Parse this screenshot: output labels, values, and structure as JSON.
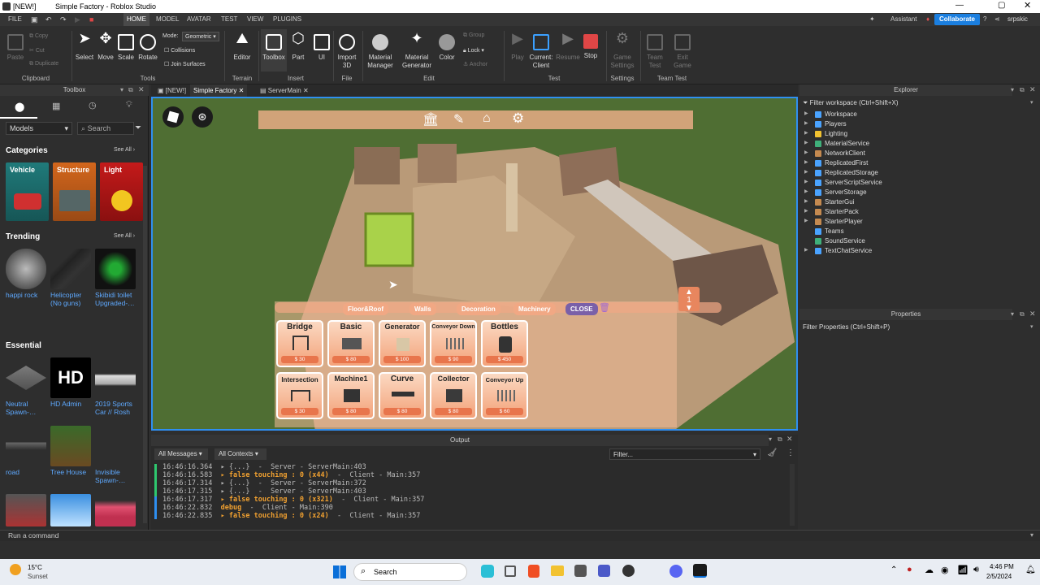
{
  "window": {
    "title_left": "[NEW!]",
    "title": "Simple Factory - Roblox Studio"
  },
  "menu": [
    "FILE",
    "HOME",
    "MODEL",
    "AVATAR",
    "TEST",
    "VIEW",
    "PLUGINS"
  ],
  "header_right": {
    "assistant": "Assistant",
    "collaborate": "Collaborate",
    "user": "srpskic"
  },
  "ribbon": {
    "clipboard": {
      "paste": "Paste",
      "copy": "Copy",
      "cut": "Cut",
      "duplicate": "Duplicate",
      "group": "Clipboard"
    },
    "tools": {
      "select": "Select",
      "move": "Move",
      "scale": "Scale",
      "rotate": "Rotate",
      "mode_label": "Mode:",
      "mode_value": "Geometric",
      "collisions": "Collisions",
      "join": "Join Surfaces",
      "group": "Tools"
    },
    "terrain": {
      "editor": "Editor",
      "group": "Terrain"
    },
    "insert": {
      "toolbox": "Toolbox",
      "part": "Part",
      "ui": "UI",
      "group": "Insert"
    },
    "file": {
      "import": "Import\n3D",
      "group": "File"
    },
    "edit": {
      "material": "Material\nManager",
      "matgen": "Material\nGenerator",
      "color": "Color",
      "group_btn": "Group",
      "lock": "Lock",
      "anchor": "Anchor",
      "group": "Edit"
    },
    "test": {
      "play": "Play",
      "current": "Current:\nClient",
      "resume": "Resume",
      "stop": "Stop",
      "group": "Test"
    },
    "settings": {
      "game": "Game\nSettings",
      "group": "Settings"
    },
    "team": {
      "teamtest": "Team\nTest",
      "exit": "Exit\nGame",
      "group": "Team Test"
    }
  },
  "toolbox": {
    "title": "Toolbox",
    "dropdown": "Models",
    "search": "Search",
    "categories_h": "Categories",
    "see_all": "See All",
    "categories": [
      "Vehicle",
      "Structure",
      "Light"
    ],
    "trending_h": "Trending",
    "trending": [
      "happi rock",
      "Helicopter\n(No guns)",
      "Skibidi toilet\nUpgraded-…"
    ],
    "essential_h": "Essential",
    "essential": [
      "Neutral\nSpawn-…",
      "HD Admin",
      "2019 Sports\nCar // Rosh",
      "road",
      "Tree House",
      "Invisible\nSpawn-…"
    ]
  },
  "doc_tabs": [
    "[NEW!]",
    "Simple Factory",
    "ServerMain"
  ],
  "game_ui": {
    "categories": [
      "Floor&Roof",
      "Walls",
      "Decoration",
      "Machinery"
    ],
    "close": "CLOSE",
    "counter": "1",
    "items": [
      {
        "name": "Bridge",
        "price": "$ 30"
      },
      {
        "name": "Basic",
        "price": "$ 80"
      },
      {
        "name": "Generator",
        "price": "$ 100"
      },
      {
        "name": "Conveyor Down",
        "price": "$ 90"
      },
      {
        "name": "Bottles",
        "price": "$ 450"
      },
      {
        "name": "Intersection",
        "price": "$ 30"
      },
      {
        "name": "Machine1",
        "price": "$ 80"
      },
      {
        "name": "Curve",
        "price": "$ 80"
      },
      {
        "name": "Collector",
        "price": "$ 80"
      },
      {
        "name": "Conveyor Up",
        "price": "$ 60"
      }
    ]
  },
  "explorer": {
    "title": "Explorer",
    "filter": "Filter workspace (Ctrl+Shift+X)",
    "items": [
      "Workspace",
      "Players",
      "Lighting",
      "MaterialService",
      "NetworkClient",
      "ReplicatedFirst",
      "ReplicatedStorage",
      "ServerScriptService",
      "ServerStorage",
      "StarterGui",
      "StarterPack",
      "StarterPlayer",
      "Teams",
      "SoundService",
      "TextChatService"
    ]
  },
  "properties": {
    "title": "Properties",
    "filter": "Filter Properties (Ctrl+Shift+P)"
  },
  "output": {
    "title": "Output",
    "all_messages": "All Messages",
    "all_contexts": "All Contexts",
    "filter": "Filter...",
    "lines": [
      {
        "t": "16:46:16.364",
        "a": "▸ {...}",
        "b": "  -  Server - ServerMain:403",
        "w": false
      },
      {
        "t": "16:46:16.583",
        "a": "▸ false touching : 0 (x44)",
        "b": "  -  Client - Main:357",
        "w": true
      },
      {
        "t": "16:46:17.314",
        "a": "▸ {...}",
        "b": "  -  Server - ServerMain:372",
        "w": false
      },
      {
        "t": "16:46:17.315",
        "a": "▸ {...}",
        "b": "  -  Server - ServerMain:403",
        "w": false
      },
      {
        "t": "16:46:17.317",
        "a": "▸ false touching : 0 (x321)",
        "b": "  -  Client - Main:357",
        "w": true
      },
      {
        "t": "16:46:22.832",
        "a": "debug",
        "b": "  -  Client - Main:390",
        "w": true
      },
      {
        "t": "16:46:22.835",
        "a": "▸ false touching : 0 (x24)",
        "b": "  -  Client - Main:357",
        "w": true
      }
    ]
  },
  "command": "Run a command",
  "taskbar": {
    "temp": "15°C",
    "weather": "Sunset",
    "search": "Search",
    "time": "4:46 PM",
    "date": "2/5/2024"
  }
}
